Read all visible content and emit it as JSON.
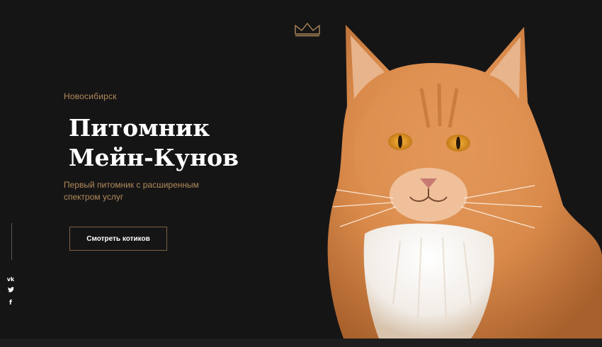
{
  "hero": {
    "city": "Новосибирск",
    "title_line1": "Питомник",
    "title_line2": "Мейн-Кунов",
    "subtitle": "Первый питомник с расширенным спектром услуг",
    "cta_label": "Смотреть котиков"
  },
  "social": {
    "vk": "vk",
    "twitter": "🐦",
    "facebook": "f"
  },
  "icons": [
    "crown-icon",
    "vk-icon",
    "twitter-icon",
    "facebook-icon"
  ],
  "colors": {
    "background": "#161516",
    "accent": "#b08a5a",
    "text": "#ffffff",
    "cat_fur": "#d98a4a"
  }
}
